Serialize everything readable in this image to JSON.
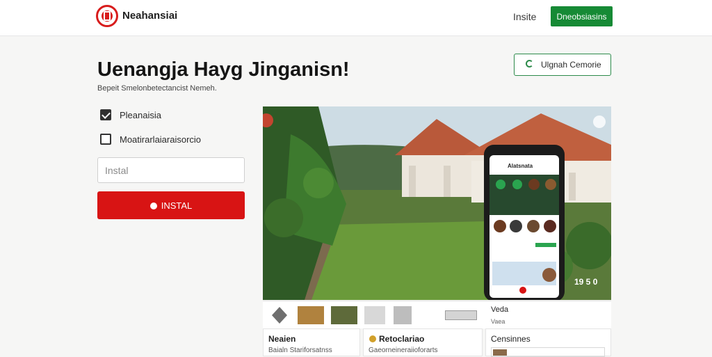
{
  "header": {
    "brand": "Neahansiai",
    "nav_link": "Insite",
    "cta_label": "Dneobsiasins"
  },
  "main": {
    "title": "Uenangja Hayg Jinganisn!",
    "subtitle": "Bepeit Smelonbetectancist Nemeh.",
    "outline_button": "Ulgnah Cemorie",
    "options": [
      {
        "label": "Pleanaisia",
        "checked": true
      },
      {
        "label": "Moatirarlaiaraisorcio",
        "checked": false
      }
    ],
    "input_placeholder": "Instal",
    "install_label": "INSTAL"
  },
  "hero": {
    "phone_title": "Alatsnata",
    "overlay_text": "19 5 0"
  },
  "strip": {
    "label_a": "Veda",
    "label_b": "Vaea"
  },
  "cards": [
    {
      "title": "Neaien",
      "subtitle": "Baialn Stariforsatnss"
    },
    {
      "title": "Retoclariao",
      "subtitle": "Gaeorneineraiioforarts"
    },
    {
      "title": "Censinnes",
      "subtitle": ""
    }
  ],
  "colors": {
    "brand_red": "#d81414",
    "brand_green": "#168a35"
  }
}
